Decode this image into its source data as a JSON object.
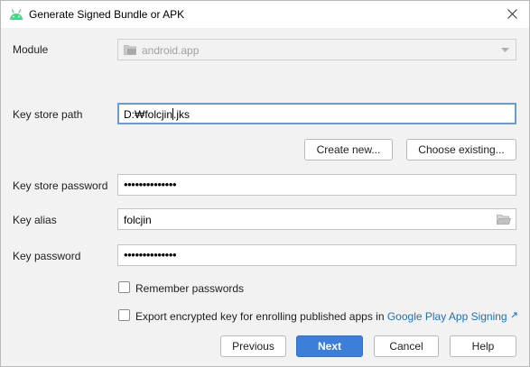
{
  "window": {
    "title": "Generate Signed Bundle or APK",
    "icon": "android-icon",
    "brand_color": "#3ddc84",
    "accent_color": "#3d7ed8"
  },
  "module": {
    "label": "Module",
    "value": "android.app"
  },
  "key_store_path": {
    "label": "Key store path",
    "value_before_cursor": "D:₩folcjin",
    "value_after_cursor": ".jks"
  },
  "key_store_buttons": {
    "create_new": "Create new...",
    "choose_existing": "Choose existing..."
  },
  "key_store_password": {
    "label": "Key store password",
    "masked_value": "••••••••••••••"
  },
  "key_alias": {
    "label": "Key alias",
    "value": "folcjin"
  },
  "key_password": {
    "label": "Key password",
    "masked_value": "••••••••••••••"
  },
  "options": {
    "remember_passwords": {
      "label": "Remember passwords",
      "checked": false
    },
    "export_key": {
      "label": "Export encrypted key for enrolling published apps in",
      "link": "Google Play App Signing",
      "checked": false
    }
  },
  "footer": {
    "previous": "Previous",
    "next": "Next",
    "cancel": "Cancel",
    "help": "Help"
  }
}
